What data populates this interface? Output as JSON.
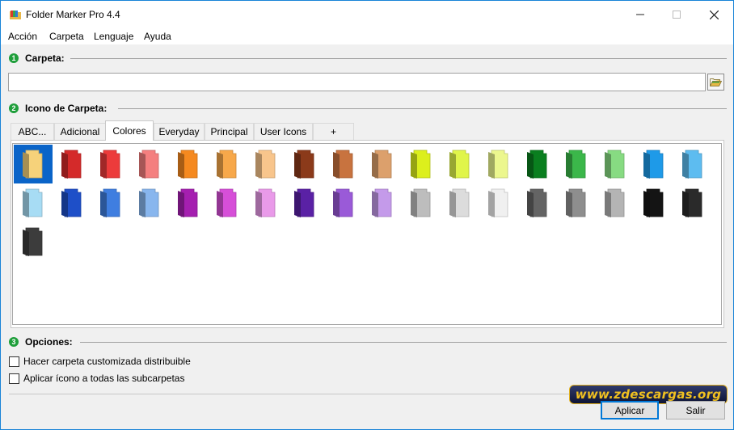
{
  "window": {
    "title": "Folder Marker Pro 4.4"
  },
  "menu": [
    "Acción",
    "Carpeta",
    "Lenguaje",
    "Ayuda"
  ],
  "sections": {
    "folder": {
      "num": "1",
      "label": "Carpeta:"
    },
    "icon": {
      "num": "2",
      "label": "Icono de Carpeta:"
    },
    "options": {
      "num": "3",
      "label": "Opciones:"
    }
  },
  "folder_input": {
    "value": ""
  },
  "tabs": [
    "ABC...",
    "Adicional",
    "Colores",
    "Everyday",
    "Principal",
    "User Icons",
    "+"
  ],
  "active_tab": "Colores",
  "folder_colors": [
    "#f6d27a",
    "#d42a2a",
    "#ec3b3b",
    "#f47f7f",
    "#f5891f",
    "#f7a84a",
    "#f8c58c",
    "#8b3a1a",
    "#c8733f",
    "#dca06c",
    "#dcef1c",
    "#e0f54a",
    "#ecf78e",
    "#0a7f1f",
    "#3bb74a",
    "#87db82",
    "#1e9ae8",
    "#5dbcf0",
    "#a7dcf4",
    "#1e4fc8",
    "#3f7ee0",
    "#88b6ee",
    "#a51fb0",
    "#d64fd8",
    "#e99ae9",
    "#5a21a5",
    "#9a5ad8",
    "#c49aea",
    "#bdbdbd",
    "#dcdcdc",
    "#f0f0f0",
    "#646464",
    "#8e8e8e",
    "#b4b4b4",
    "#141414",
    "#2a2a2a",
    "#3c3c3c"
  ],
  "options": {
    "distributable": {
      "label": "Hacer carpeta customizada distribuible",
      "checked": false
    },
    "apply_subfolders": {
      "label": "Aplicar ícono a todas las subcarpetas",
      "checked": false
    }
  },
  "buttons": {
    "apply": "Aplicar",
    "exit": "Salir"
  },
  "watermark": "www.zdescargas.org"
}
